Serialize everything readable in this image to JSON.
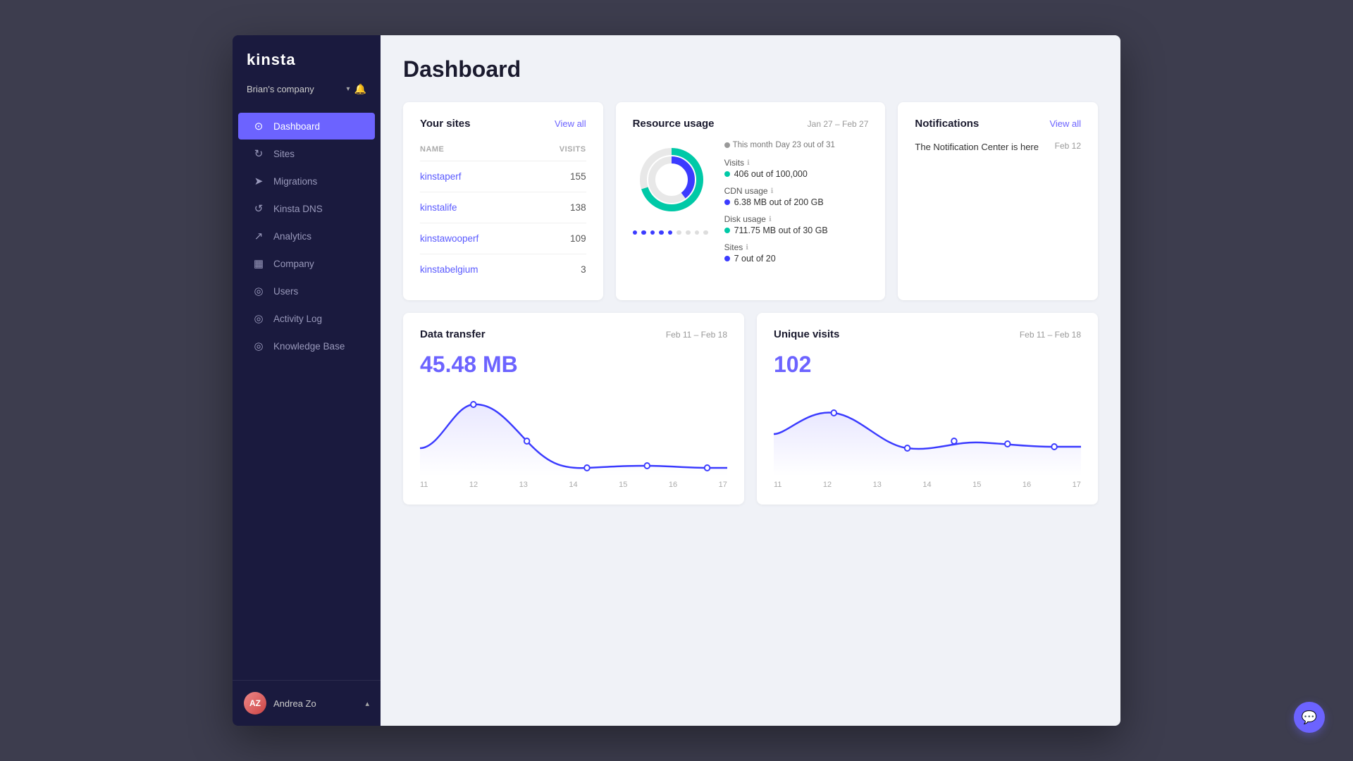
{
  "sidebar": {
    "logo": "kinsta",
    "company": "Brian's company",
    "nav": [
      {
        "id": "dashboard",
        "label": "Dashboard",
        "icon": "⊙",
        "active": true
      },
      {
        "id": "sites",
        "label": "Sites",
        "icon": "↻"
      },
      {
        "id": "migrations",
        "label": "Migrations",
        "icon": "➤"
      },
      {
        "id": "kinsta-dns",
        "label": "Kinsta DNS",
        "icon": "↺"
      },
      {
        "id": "analytics",
        "label": "Analytics",
        "icon": "↗"
      },
      {
        "id": "company",
        "label": "Company",
        "icon": "▦"
      },
      {
        "id": "users",
        "label": "Users",
        "icon": "👤"
      },
      {
        "id": "activity-log",
        "label": "Activity Log",
        "icon": "◎"
      },
      {
        "id": "knowledge-base",
        "label": "Knowledge Base",
        "icon": "◎"
      }
    ],
    "user": {
      "name": "Andrea Zo",
      "initials": "AZ"
    }
  },
  "page": {
    "title": "Dashboard"
  },
  "your_sites": {
    "title": "Your sites",
    "view_all": "View all",
    "columns": {
      "name": "NAME",
      "visits": "VISITS"
    },
    "sites": [
      {
        "name": "kinstaperf",
        "visits": "155"
      },
      {
        "name": "kinstalife",
        "visits": "138"
      },
      {
        "name": "kinstawooperf",
        "visits": "109"
      },
      {
        "name": "kinstabelgium",
        "visits": "3"
      }
    ]
  },
  "resource_usage": {
    "title": "Resource usage",
    "date_range": "Jan 27 – Feb 27",
    "this_month_label": "This month",
    "day_out_of": "Day 23 out of 31",
    "metrics": [
      {
        "label": "Visits",
        "value": "406 out of 100,000",
        "dot": "teal"
      },
      {
        "label": "CDN usage",
        "value": "6.38 MB out of 200 GB",
        "dot": "blue"
      },
      {
        "label": "Disk usage",
        "value": "711.75 MB out of 30 GB",
        "dot": "teal"
      },
      {
        "label": "Sites",
        "value": "7 out of 20",
        "dot": "blue"
      }
    ],
    "donut": {
      "teal_pct": 70,
      "blue_pct": 40
    }
  },
  "notifications": {
    "title": "Notifications",
    "view_all": "View all",
    "items": [
      {
        "text": "The Notification Center is here",
        "date": "Feb 12"
      }
    ]
  },
  "data_transfer": {
    "title": "Data transfer",
    "date_range": "Feb 11 – Feb 18",
    "value": "45.48 MB",
    "x_labels": [
      "11",
      "12",
      "13",
      "14",
      "15",
      "16",
      "17"
    ]
  },
  "unique_visits": {
    "title": "Unique visits",
    "date_range": "Feb 11 – Feb 18",
    "value": "102",
    "x_labels": [
      "11",
      "12",
      "13",
      "14",
      "15",
      "16",
      "17"
    ]
  }
}
